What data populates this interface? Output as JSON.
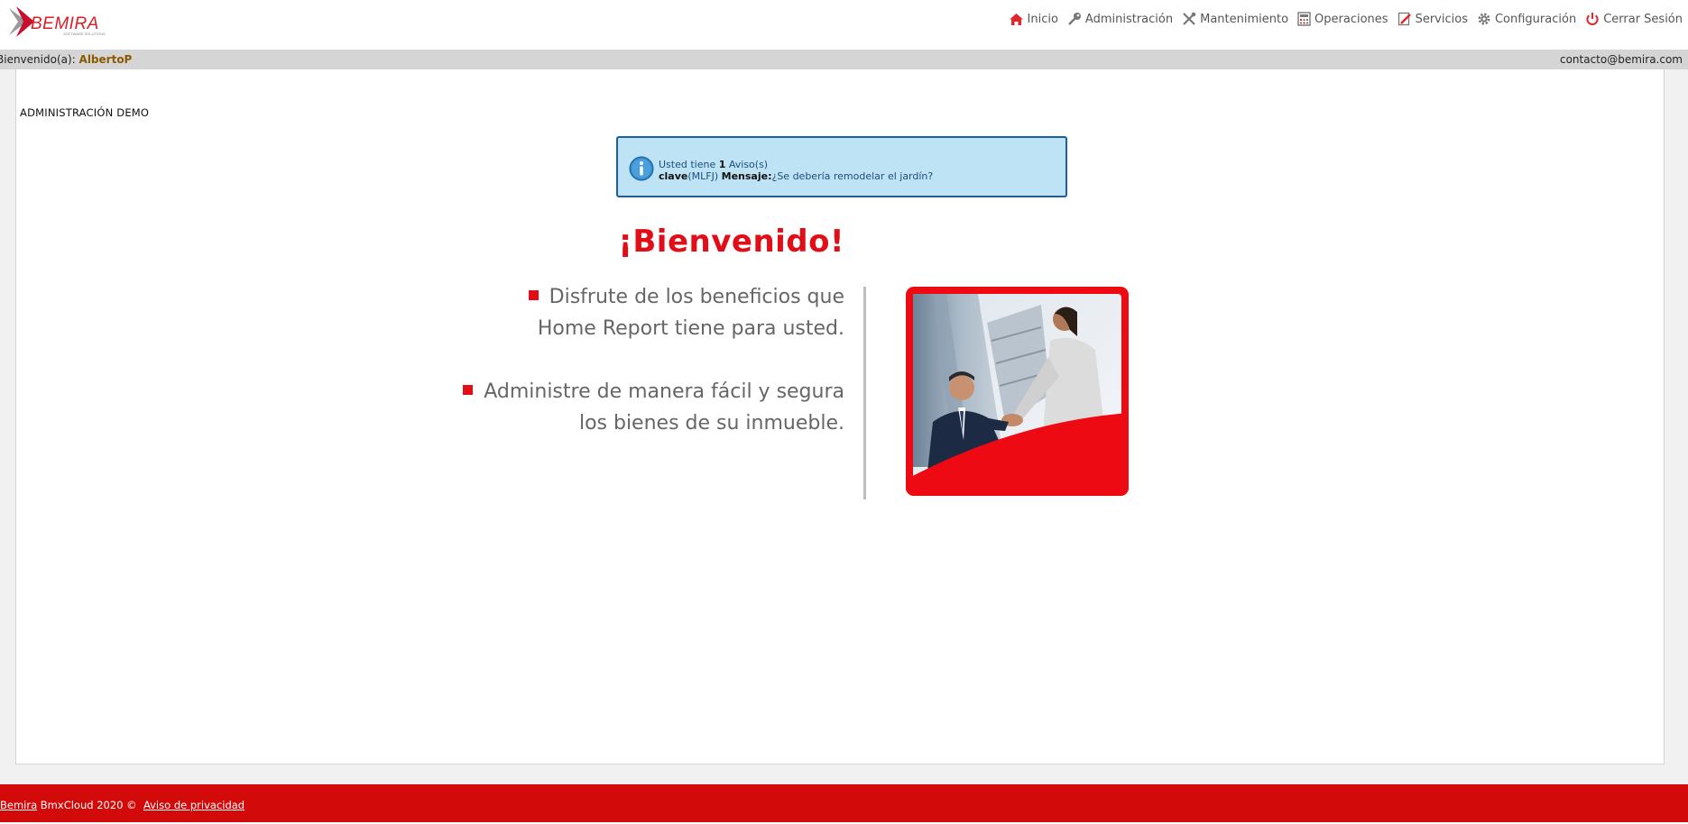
{
  "header": {
    "logo_text": "BEMIRA",
    "logo_tagline": "SOFTWARE SOLUTIONS",
    "nav": [
      {
        "label": "Inicio",
        "icon": "home-icon"
      },
      {
        "label": "Administración",
        "icon": "key-icon"
      },
      {
        "label": "Mantenimiento",
        "icon": "tools-icon"
      },
      {
        "label": "Operaciones",
        "icon": "calculator-icon"
      },
      {
        "label": "Servicios",
        "icon": "edit-doc-icon"
      },
      {
        "label": "Configuración",
        "icon": "gear-icon"
      },
      {
        "label": "Cerrar Sesión",
        "icon": "power-icon"
      }
    ]
  },
  "userbar": {
    "welcome_label": "Bienvenido(a):",
    "username": "AlbertoP",
    "contact": "contacto@bemira.com"
  },
  "main": {
    "section_title": "ADMINISTRACIÓN DEMO",
    "notice": {
      "prefix": "Usted tiene ",
      "count": "1",
      "suffix": " Aviso(s)",
      "key_label": "clave",
      "key_value": "(MLFJ)",
      "message_label": "Mensaje:",
      "message": "¿Se debería remodelar el jardín?"
    },
    "heading": "¡Bienvenido!",
    "bullets": [
      {
        "line1": "Disfrute de los beneficios que",
        "line2": "Home Report tiene para usted."
      },
      {
        "line1": "Administre de manera fácil y segura",
        "line2": "los bienes de su inmueble."
      }
    ]
  },
  "footer": {
    "brand_link": "Bemira",
    "copyright": " BmxCloud 2020 ©  ",
    "privacy_link": "Aviso de privacidad"
  },
  "colors": {
    "brand_red": "#e10d17",
    "footer_red": "#d20a0a",
    "notice_bg": "#bde3f4",
    "notice_border": "#1b5f9e"
  }
}
